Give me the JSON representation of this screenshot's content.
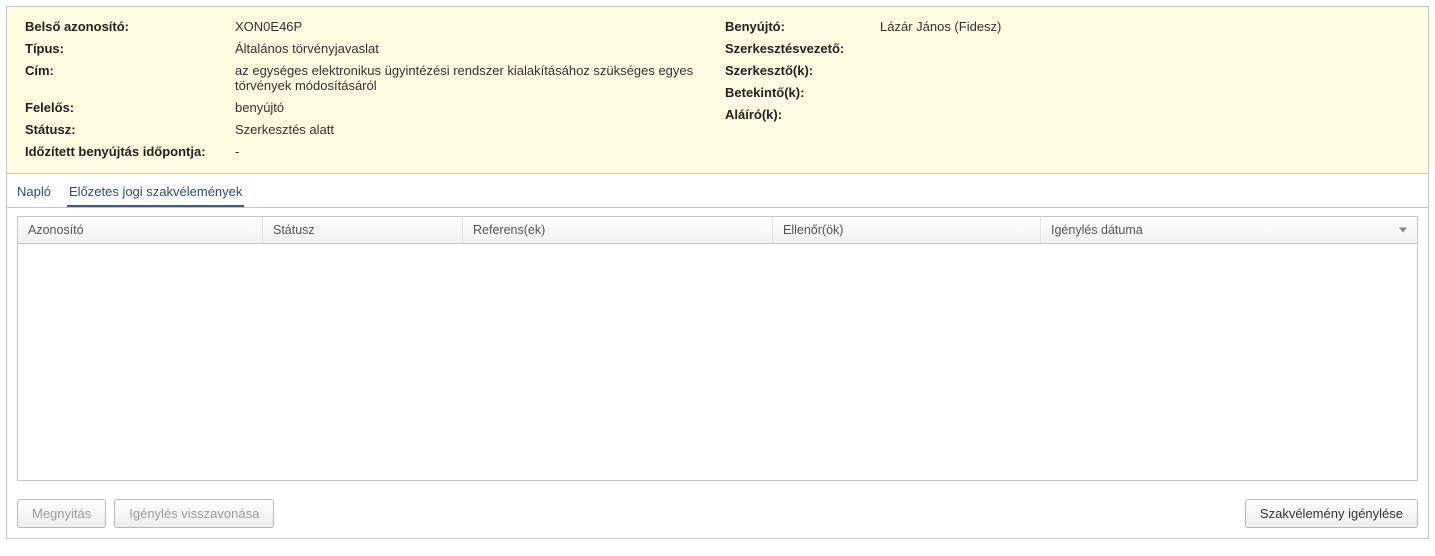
{
  "info": {
    "labels": {
      "belso_azonosito": "Belső azonosító:",
      "tipus": "Típus:",
      "cim": "Cím:",
      "felelos": "Felelős:",
      "statusz": "Státusz:",
      "idozitett": "Időzített benyújtás időpontja:",
      "benyujto": "Benyújtó:",
      "szerkvez": "Szerkesztésvezető:",
      "szerkk": "Szerkesztő(k):",
      "betekintok": "Betekintő(k):",
      "alairok": "Aláíró(k):"
    },
    "values": {
      "belso_azonosito": "XON0E46P",
      "tipus": "Általános törvényjavaslat",
      "cim": "az egységes elektronikus ügyintézési rendszer kialakításához szükséges egyes törvények módosításáról",
      "felelos": "benyújtó",
      "statusz": "Szerkesztés alatt",
      "idozitett": "-",
      "benyujto": "Lázár János (Fidesz)",
      "szerkvez": "",
      "szerkk": "",
      "betekintok": "",
      "alairok": ""
    }
  },
  "tabs": {
    "naplo": "Napló",
    "elozetes": "Előzetes jogi szakvélemények"
  },
  "grid": {
    "headers": {
      "azonosito": "Azonosító",
      "statusz": "Státusz",
      "referensek": "Referens(ek)",
      "ellenorok": "Ellenőr(ök)",
      "igenyles_datuma": "Igénylés dátuma"
    },
    "rows": []
  },
  "buttons": {
    "megnyitas": "Megnyitás",
    "visszavonas": "Igénylés visszavonása",
    "igenyles": "Szakvélemény igénylése"
  }
}
